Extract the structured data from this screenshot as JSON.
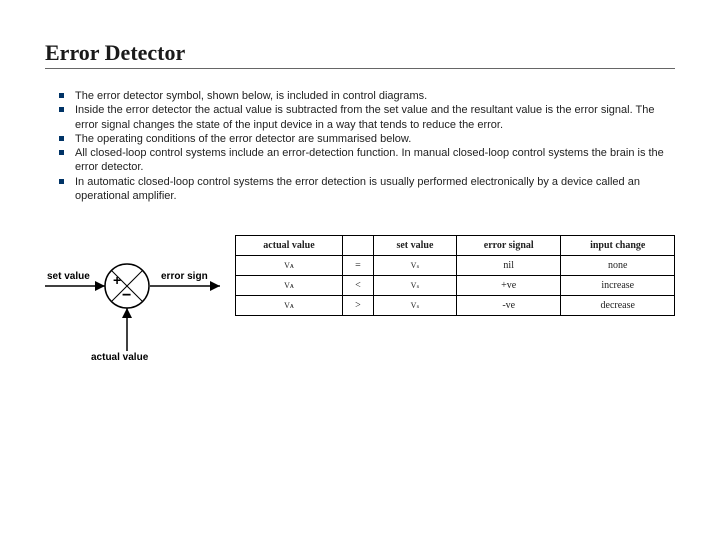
{
  "title": "Error Detector",
  "bullets": [
    "The error detector symbol, shown below, is included in control diagrams.",
    "Inside the error detector the actual value is subtracted from the set value and the resultant value is the error signal. The error signal changes the state of the input device in a way that tends to reduce the error.",
    "The operating conditions of the error detector are summarised below.",
    "All closed-loop control systems include an error-detection function. In manual closed-loop control systems the brain is the error detector.",
    "In automatic closed-loop control systems the error detection is usually performed electronically by a device called an operational amplifier."
  ],
  "diagram": {
    "set_label": "set value",
    "error_label": "error sign",
    "actual_label": "actual value",
    "plus": "+",
    "minus": "−"
  },
  "table": {
    "headers": [
      "actual value",
      "",
      "set value",
      "error signal",
      "input change"
    ],
    "rows": [
      {
        "actual": "Vᴀ",
        "op": "=",
        "set": "Vₛ",
        "error": "nil",
        "change": "none"
      },
      {
        "actual": "Vᴀ",
        "op": "<",
        "set": "Vₛ",
        "error": "+ve",
        "change": "increase"
      },
      {
        "actual": "Vᴀ",
        "op": ">",
        "set": "Vₛ",
        "error": "-ve",
        "change": "decrease"
      }
    ]
  }
}
